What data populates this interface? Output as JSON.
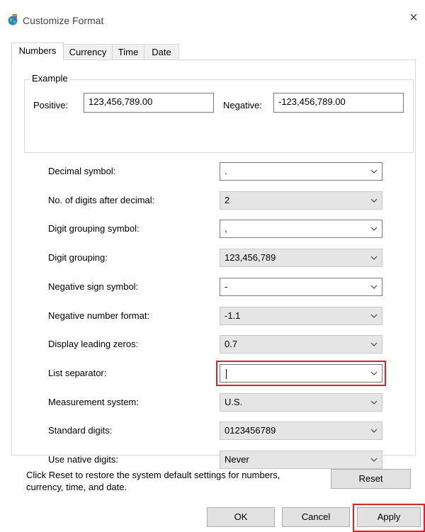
{
  "window": {
    "title": "Customize Format",
    "close_glyph": "×"
  },
  "tabs": [
    {
      "label": "Numbers",
      "active": true
    },
    {
      "label": "Currency",
      "active": false
    },
    {
      "label": "Time",
      "active": false
    },
    {
      "label": "Date",
      "active": false
    }
  ],
  "example": {
    "legend": "Example",
    "positive_label": "Positive:",
    "positive_value": "123,456,789.00",
    "negative_label": "Negative:",
    "negative_value": "-123,456,789.00"
  },
  "settings": [
    {
      "label": "Decimal symbol:",
      "value": ".",
      "style": "editable"
    },
    {
      "label": "No. of digits after decimal:",
      "value": "2",
      "style": "dropdown"
    },
    {
      "label": "Digit grouping symbol:",
      "value": ",",
      "style": "editable"
    },
    {
      "label": "Digit grouping:",
      "value": "123,456,789",
      "style": "dropdown"
    },
    {
      "label": "Negative sign symbol:",
      "value": "-",
      "style": "editable"
    },
    {
      "label": "Negative number format:",
      "value": "-1.1",
      "style": "dropdown"
    },
    {
      "label": "Display leading zeros:",
      "value": "0.7",
      "style": "dropdown"
    },
    {
      "label": "List separator:",
      "value": "",
      "style": "editable",
      "highlighted": true,
      "focused": true
    },
    {
      "label": "Measurement system:",
      "value": "U.S.",
      "style": "dropdown"
    },
    {
      "label": "Standard digits:",
      "value": "0123456789",
      "style": "dropdown"
    },
    {
      "label": "Use native digits:",
      "value": "Never",
      "style": "dropdown"
    }
  ],
  "info": {
    "text": "Click Reset to restore the system default settings for numbers, currency, time, and date."
  },
  "buttons": {
    "reset": "Reset",
    "ok": "OK",
    "cancel": "Cancel",
    "apply": "Apply"
  },
  "colors": {
    "highlight": "#e0212b",
    "dropdown_bg": "#e5e5e5",
    "button_bg": "#e1e1e1"
  }
}
